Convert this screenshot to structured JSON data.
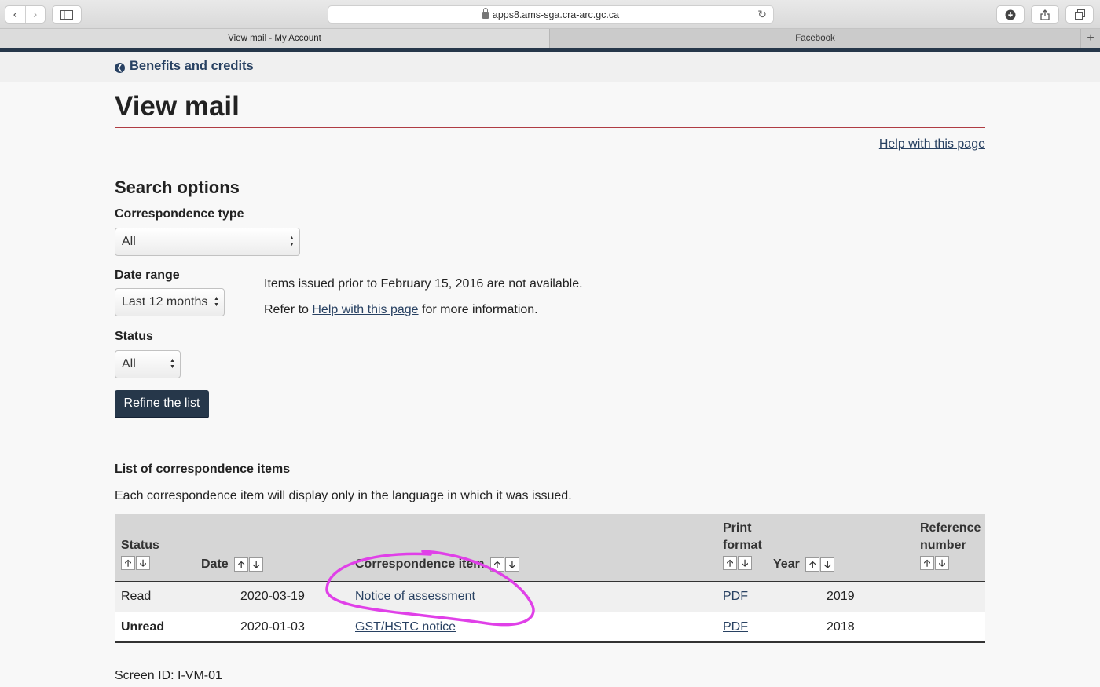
{
  "browser": {
    "url": "apps8.ams-sga.cra-arc.gc.ca",
    "tabs": [
      {
        "label": "View mail - My Account",
        "active": true
      },
      {
        "label": "Facebook",
        "active": false
      }
    ],
    "accent_color": "#26374a"
  },
  "breadcrumb": {
    "label": "Benefits and credits"
  },
  "page": {
    "title": "View mail",
    "help_link": "Help with this page"
  },
  "search": {
    "heading": "Search options",
    "correspondence_type": {
      "label": "Correspondence type",
      "value": "All"
    },
    "date_range": {
      "label": "Date range",
      "value": "Last 12 months"
    },
    "status": {
      "label": "Status",
      "value": "All"
    },
    "info_line1": "Items issued prior to February 15, 2016 are not available.",
    "info_prefix": "Refer to",
    "info_link": "Help with this page",
    "info_suffix": "for more information.",
    "refine_button": "Refine the list"
  },
  "list": {
    "heading": "List of correspondence items",
    "description": "Each correspondence item will display only in the language in which it was issued.",
    "columns": {
      "status": "Status",
      "date": "Date",
      "item": "Correspondence item",
      "print_format_line1": "Print",
      "print_format_line2": "format",
      "year": "Year",
      "reference_line1": "Reference",
      "reference_line2": "number"
    },
    "rows": [
      {
        "status": "Read",
        "date": "2020-03-19",
        "item": "Notice of assessment",
        "format": "PDF",
        "year": "2019",
        "reference": ""
      },
      {
        "status": "Unread",
        "date": "2020-01-03",
        "item": "GST/HSTC notice",
        "format": "PDF",
        "year": "2018",
        "reference": ""
      }
    ]
  },
  "footer": {
    "screen_id": "Screen ID: I-VM-01"
  },
  "annotation": {
    "color": "#e040e8"
  }
}
